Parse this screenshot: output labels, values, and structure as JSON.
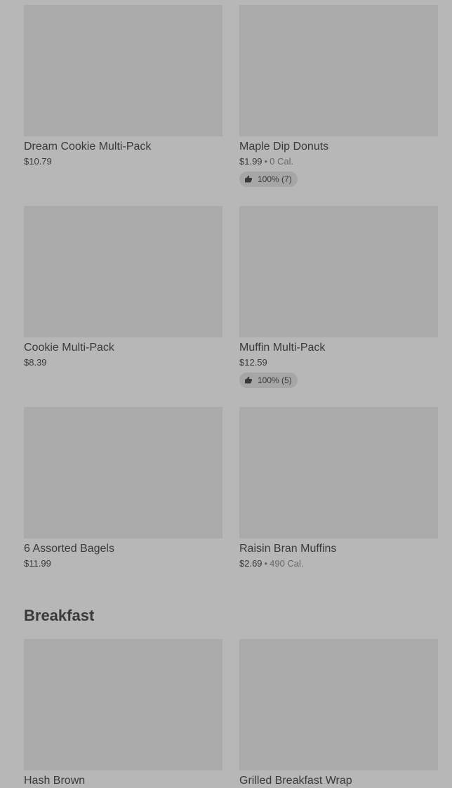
{
  "items": [
    {
      "name": "Dream Cookie Multi-Pack",
      "price": "$10.79"
    },
    {
      "name": "Maple Dip Donuts",
      "price": "$1.99",
      "dot": "•",
      "calories": "0 Cal.",
      "rating": "100% (7)"
    },
    {
      "name": "Cookie Multi-Pack",
      "price": "$8.39"
    },
    {
      "name": "Muffin Multi-Pack",
      "price": "$12.59",
      "rating": "100% (5)"
    },
    {
      "name": "6 Assorted Bagels",
      "price": "$11.99"
    },
    {
      "name": "Raisin Bran Muffins",
      "price": "$2.69",
      "dot": "•",
      "calories": "490 Cal."
    }
  ],
  "breakfast": {
    "title": "Breakfast",
    "items": [
      {
        "name": "Hash Brown"
      },
      {
        "name": "Grilled Breakfast Wrap"
      }
    ]
  },
  "icons": {
    "rating": "thumbs-up-icon"
  },
  "colors": {
    "overlay_bg": "#b7b7b7",
    "placeholder": "#aaaaaa",
    "text": "#3a3a3a"
  }
}
